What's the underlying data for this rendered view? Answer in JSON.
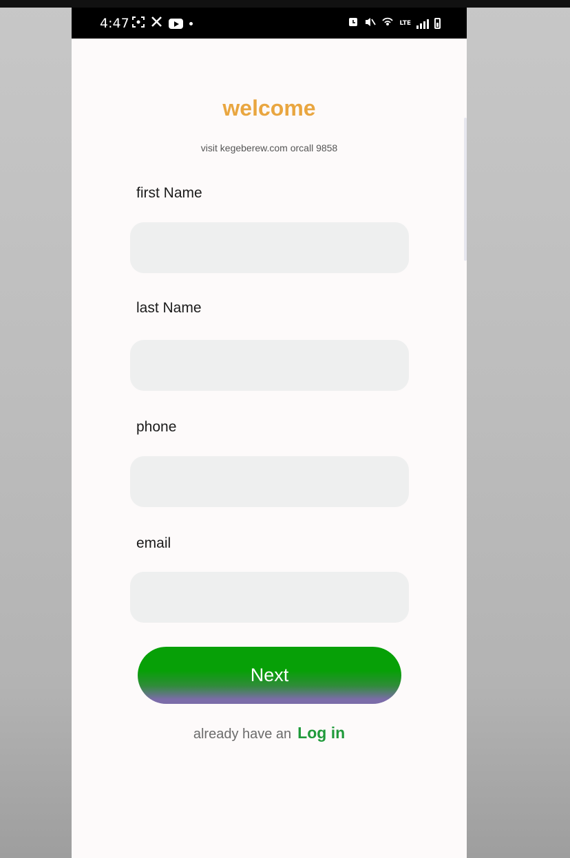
{
  "status_bar": {
    "time": "4:47",
    "left_icons": [
      "screenshot-icon",
      "x-icon",
      "youtube-icon",
      "notification-dot-icon"
    ],
    "right_icons": [
      "alarm-icon",
      "mute-icon",
      "hotspot-icon",
      "lte-icon",
      "signal-icon",
      "battery-icon"
    ],
    "lte_label": "LTE"
  },
  "header": {
    "title": "welcome",
    "subtitle": "visit kegeberew.com orcall 9858"
  },
  "form": {
    "fields": [
      {
        "label": "first Name",
        "value": "",
        "placeholder": ""
      },
      {
        "label": "last Name",
        "value": "",
        "placeholder": ""
      },
      {
        "label": "phone",
        "value": "",
        "placeholder": ""
      },
      {
        "label": "email",
        "value": "",
        "placeholder": ""
      }
    ],
    "next_label": "Next"
  },
  "footer": {
    "prompt": "already have an",
    "login_label": "Log in"
  },
  "colors": {
    "title": "#e9a640",
    "button_green": "#07a007",
    "button_purple": "#7b6ca8",
    "link_green": "#1f9a3a",
    "input_bg": "#eeefef",
    "screen_bg": "#fdfafa"
  }
}
